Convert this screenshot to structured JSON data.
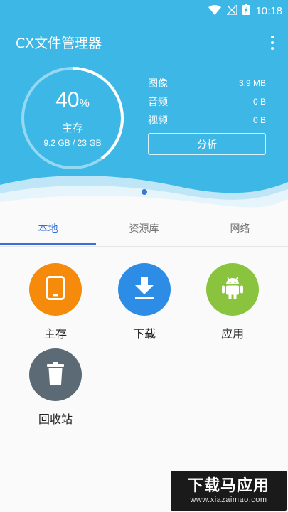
{
  "status": {
    "time": "10:18"
  },
  "app": {
    "title": "CX文件管理器"
  },
  "storage": {
    "percent": "40",
    "percent_sign": "%",
    "percent_value": 0.4,
    "label": "主存",
    "usage": "9.2 GB / 23 GB"
  },
  "stats": [
    {
      "name": "图像",
      "value": "3.9 MB"
    },
    {
      "name": "音频",
      "value": "0 B"
    },
    {
      "name": "视频",
      "value": "0 B"
    }
  ],
  "analyze_label": "分析",
  "tabs": [
    {
      "label": "本地",
      "active": true
    },
    {
      "label": "资源库",
      "active": false
    },
    {
      "label": "网络",
      "active": false
    }
  ],
  "tiles": [
    {
      "label": "主存",
      "icon": "tablet-icon",
      "color": "#f58a0b"
    },
    {
      "label": "下载",
      "icon": "download-icon",
      "color": "#2d8de6"
    },
    {
      "label": "应用",
      "icon": "android-icon",
      "color": "#8ac43f"
    },
    {
      "label": "回收站",
      "icon": "trash-icon",
      "color": "#5b6a75"
    }
  ],
  "watermark": {
    "main": "下载马应用",
    "url": "www.xiazaimao.com"
  },
  "colors": {
    "header": "#3db8e6",
    "accent": "#2f6fd6"
  }
}
